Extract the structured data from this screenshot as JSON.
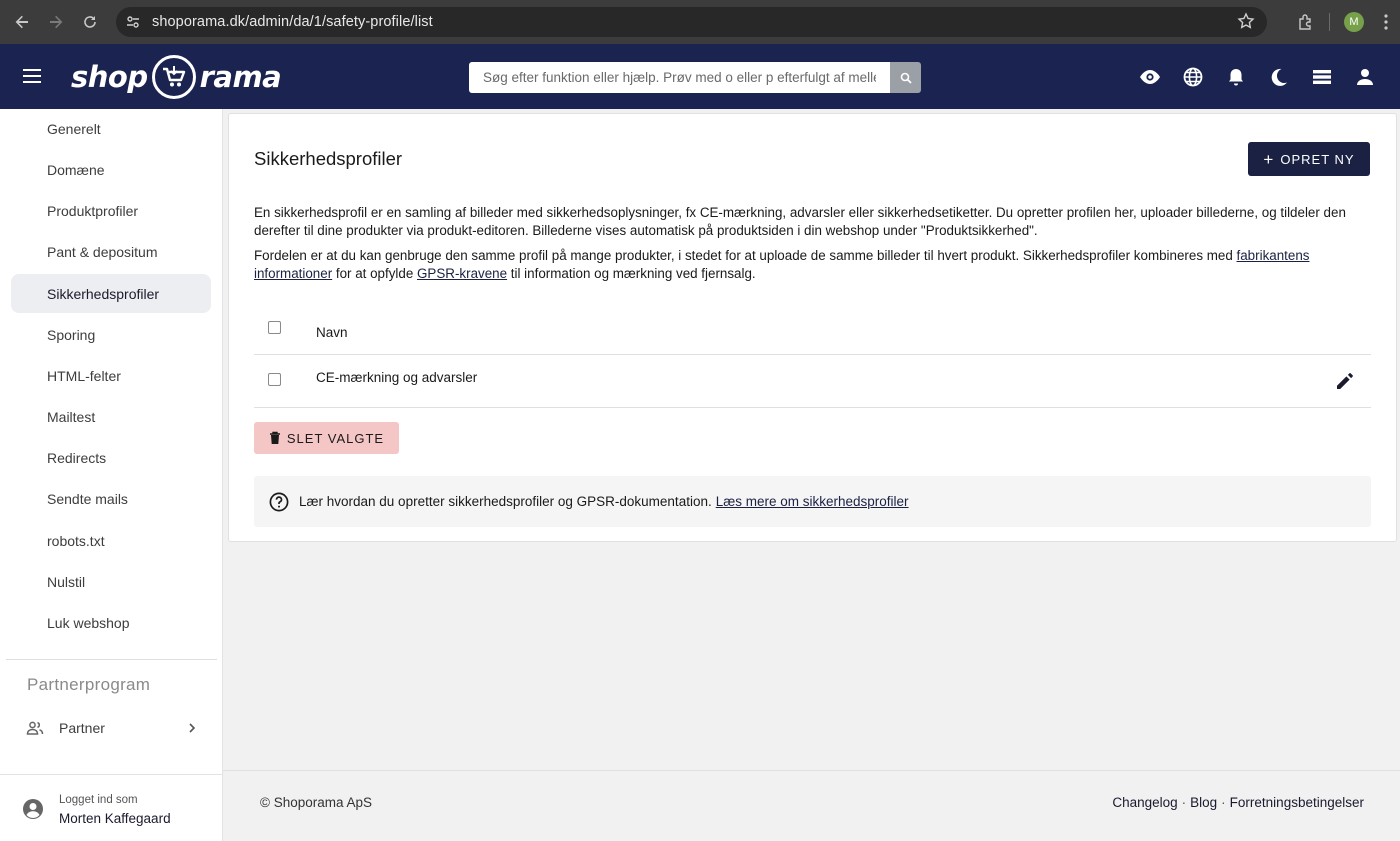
{
  "browser": {
    "url": "shoporama.dk/admin/da/1/safety-profile/list",
    "profile_initial": "M"
  },
  "header": {
    "logo_left": "shop",
    "logo_right": "rama",
    "search_placeholder": "Søg efter funktion eller hjælp. Prøv med o eller p efterfulgt af mellemrum"
  },
  "sidebar": {
    "items": [
      {
        "label": "Generelt"
      },
      {
        "label": "Domæne"
      },
      {
        "label": "Produktprofiler"
      },
      {
        "label": "Pant & depositum"
      },
      {
        "label": "Sikkerhedsprofiler",
        "active": true
      },
      {
        "label": "Sporing"
      },
      {
        "label": "HTML-felter"
      },
      {
        "label": "Mailtest"
      },
      {
        "label": "Redirects"
      },
      {
        "label": "Sendte mails"
      },
      {
        "label": "robots.txt"
      },
      {
        "label": "Nulstil"
      },
      {
        "label": "Luk webshop"
      }
    ],
    "section_title": "Partnerprogram",
    "partner_label": "Partner",
    "login_caption": "Logget ind som",
    "login_name": "Morten Kaffegaard"
  },
  "main": {
    "title": "Sikkerhedsprofiler",
    "new_button": "OPRET NY",
    "para1": "En sikkerhedsprofil er en samling af billeder med sikkerhedsoplysninger, fx CE-mærkning, advarsler eller sikkerhedsetiketter. Du opretter profilen her, uploader billederne, og tildeler den derefter til dine produkter via produkt-editoren. Billederne vises automatisk på produktsiden i din webshop under \"Produktsikkerhed\".",
    "para2_a": "Fordelen er at du kan genbruge den samme profil på mange produkter, i stedet for at uploade de samme billeder til hvert produkt. Sikkerhedsprofiler kombineres med ",
    "para2_link1": "fabrikantens informationer",
    "para2_b": " for at opfylde ",
    "para2_link2": "GPSR-kravene",
    "para2_c": " til information og mærkning ved fjernsalg.",
    "table": {
      "header": "Navn",
      "rows": [
        {
          "name": "CE-mærkning og advarsler"
        }
      ]
    },
    "delete_button": "SLET VALGTE",
    "info_text": "Lær hvordan du opretter sikkerhedsprofiler og GPSR-dokumentation.",
    "info_link": "Læs mere om sikkerhedsprofiler"
  },
  "footer": {
    "copyright": "© Shoporama ApS",
    "links": [
      "Changelog",
      "Blog",
      "Forretningsbetingelser"
    ]
  }
}
